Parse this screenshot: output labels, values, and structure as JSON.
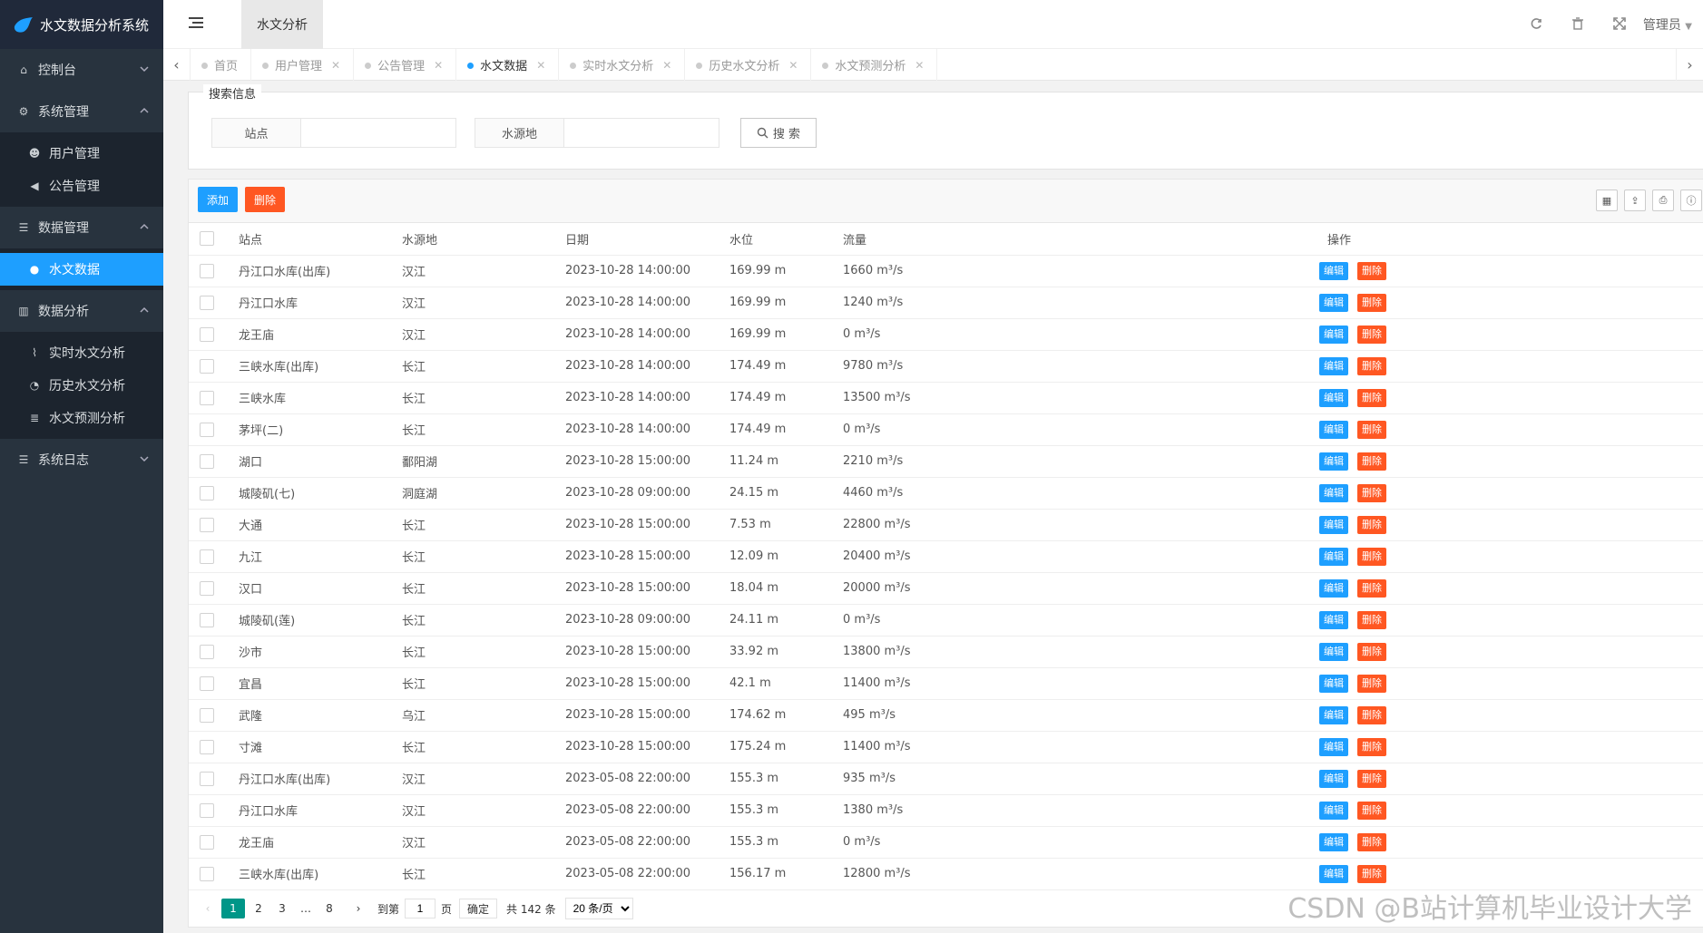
{
  "app": {
    "title": "水文数据分析系统"
  },
  "sidebar": {
    "items": [
      {
        "label": "控制台",
        "icon": "home-icon"
      },
      {
        "label": "系统管理",
        "icon": "cogs-icon",
        "children": [
          {
            "label": "用户管理",
            "icon": "users-icon"
          },
          {
            "label": "公告管理",
            "icon": "volume-icon"
          }
        ]
      },
      {
        "label": "数据管理",
        "icon": "list-icon",
        "children": [
          {
            "label": "水文数据",
            "icon": "globe-icon",
            "active": true
          }
        ]
      },
      {
        "label": "数据分析",
        "icon": "bar-chart-icon",
        "children": [
          {
            "label": "实时水文分析",
            "icon": "line-chart-icon"
          },
          {
            "label": "历史水文分析",
            "icon": "pie-chart-icon"
          },
          {
            "label": "水文预测分析",
            "icon": "database-icon"
          }
        ]
      },
      {
        "label": "系统日志",
        "icon": "list-icon"
      }
    ]
  },
  "header": {
    "tab": "水文分析",
    "user": "管理员"
  },
  "tabs": [
    {
      "label": "首页"
    },
    {
      "label": "用户管理",
      "closable": true
    },
    {
      "label": "公告管理",
      "closable": true
    },
    {
      "label": "水文数据",
      "closable": true,
      "active": true
    },
    {
      "label": "实时水文分析",
      "closable": true
    },
    {
      "label": "历史水文分析",
      "closable": true
    },
    {
      "label": "水文预测分析",
      "closable": true
    }
  ],
  "search": {
    "legend": "搜索信息",
    "station_label": "站点",
    "source_label": "水源地",
    "button": "搜 索"
  },
  "toolbar": {
    "add": "添加",
    "delete": "删除"
  },
  "table": {
    "columns": [
      "站点",
      "水源地",
      "日期",
      "水位",
      "流量",
      "操作"
    ],
    "row_edit": "编辑",
    "row_delete": "删除",
    "rows": [
      [
        "丹江口水库(出库)",
        "汉江",
        "2023-10-28 14:00:00",
        "169.99 m",
        "1660 m³/s"
      ],
      [
        "丹江口水库",
        "汉江",
        "2023-10-28 14:00:00",
        "169.99 m",
        "1240 m³/s"
      ],
      [
        "龙王庙",
        "汉江",
        "2023-10-28 14:00:00",
        "169.99 m",
        "0 m³/s"
      ],
      [
        "三峡水库(出库)",
        "长江",
        "2023-10-28 14:00:00",
        "174.49 m",
        "9780 m³/s"
      ],
      [
        "三峡水库",
        "长江",
        "2023-10-28 14:00:00",
        "174.49 m",
        "13500 m³/s"
      ],
      [
        "茅坪(二)",
        "长江",
        "2023-10-28 14:00:00",
        "174.49 m",
        "0 m³/s"
      ],
      [
        "湖口",
        "鄱阳湖",
        "2023-10-28 15:00:00",
        "11.24 m",
        "2210 m³/s"
      ],
      [
        "城陵矶(七)",
        "洞庭湖",
        "2023-10-28 09:00:00",
        "24.15 m",
        "4460 m³/s"
      ],
      [
        "大通",
        "长江",
        "2023-10-28 15:00:00",
        "7.53 m",
        "22800 m³/s"
      ],
      [
        "九江",
        "长江",
        "2023-10-28 15:00:00",
        "12.09 m",
        "20400 m³/s"
      ],
      [
        "汉口",
        "长江",
        "2023-10-28 15:00:00",
        "18.04 m",
        "20000 m³/s"
      ],
      [
        "城陵矶(莲)",
        "长江",
        "2023-10-28 09:00:00",
        "24.11 m",
        "0 m³/s"
      ],
      [
        "沙市",
        "长江",
        "2023-10-28 15:00:00",
        "33.92 m",
        "13800 m³/s"
      ],
      [
        "宜昌",
        "长江",
        "2023-10-28 15:00:00",
        "42.1 m",
        "11400 m³/s"
      ],
      [
        "武隆",
        "乌江",
        "2023-10-28 15:00:00",
        "174.62 m",
        "495 m³/s"
      ],
      [
        "寸滩",
        "长江",
        "2023-10-28 15:00:00",
        "175.24 m",
        "11400 m³/s"
      ],
      [
        "丹江口水库(出库)",
        "汉江",
        "2023-05-08 22:00:00",
        "155.3 m",
        "935 m³/s"
      ],
      [
        "丹江口水库",
        "汉江",
        "2023-05-08 22:00:00",
        "155.3 m",
        "1380 m³/s"
      ],
      [
        "龙王庙",
        "汉江",
        "2023-05-08 22:00:00",
        "155.3 m",
        "0 m³/s"
      ],
      [
        "三峡水库(出库)",
        "长江",
        "2023-05-08 22:00:00",
        "156.17 m",
        "12800 m³/s"
      ]
    ]
  },
  "pager": {
    "pages": [
      "1",
      "2",
      "3",
      "…",
      "8"
    ],
    "current": "1",
    "goto_label": "到第",
    "goto_value": "1",
    "page_unit": "页",
    "confirm": "确定",
    "total": "共 142 条",
    "page_size": "20 条/页"
  },
  "watermark": "CSDN @B站计算机毕业设计大学"
}
